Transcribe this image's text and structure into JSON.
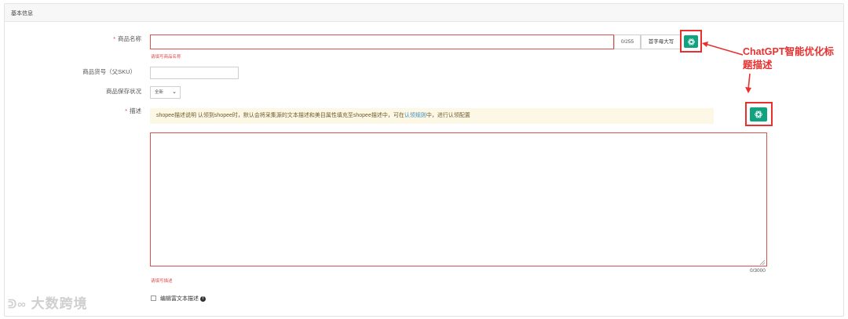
{
  "panel": {
    "title": "基本信息"
  },
  "fields": {
    "product_name": {
      "label": "商品名称",
      "required_mark": "*",
      "value": "",
      "counter": "0/255",
      "capitalize_button": "首字母大写",
      "error": "请填写商品名称"
    },
    "sku": {
      "label": "商品货号（父SKU）",
      "value": ""
    },
    "condition": {
      "label": "商品保存状况",
      "selected": "全新"
    },
    "description": {
      "label": "描述",
      "required_mark": "*",
      "notice_prefix": "shopee描述说明 认领到shopee时，默认会将采集源的文本描述和美目属性填充至shopee描述中，可在",
      "notice_link": "认领规则",
      "notice_suffix": "中，进行认领配置",
      "value": "",
      "counter": "0/3000",
      "error": "请填写描述"
    },
    "rich_text": {
      "label": "编辑富文本描述"
    }
  },
  "annotation": {
    "line1": "ChatGPT智能优化标",
    "line2": "题描述"
  },
  "watermark": "大数跨境",
  "icons": {
    "gpt_title": "chatgpt-icon",
    "gpt_desc": "chatgpt-icon",
    "info": "info-icon",
    "chevron": "chevron-down-icon"
  },
  "colors": {
    "gpt": "#10a37f",
    "error": "#e2484b",
    "annotation": "#e8302f",
    "notice_bg": "#fdf8e5"
  }
}
